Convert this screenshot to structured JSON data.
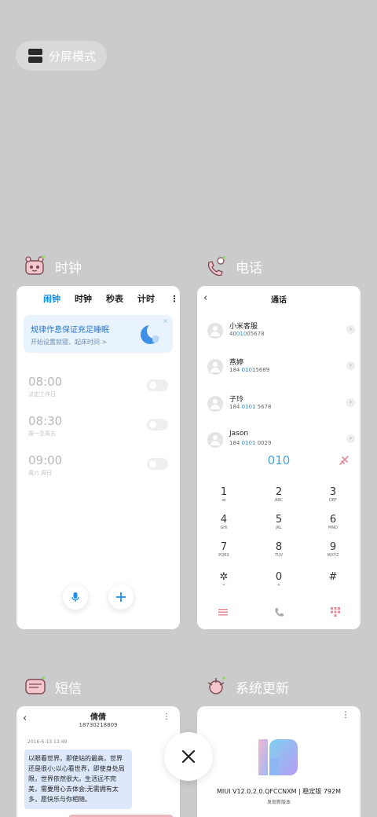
{
  "split_screen": {
    "label": "分屏模式",
    "icon": "split-screen-icon"
  },
  "apps": {
    "clock": {
      "name": "时钟",
      "icon": "clock-app-icon"
    },
    "phone": {
      "name": "电话",
      "icon": "phone-app-icon"
    },
    "sms": {
      "name": "短信",
      "icon": "sms-app-icon"
    },
    "update": {
      "name": "系统更新",
      "icon": "update-app-icon"
    }
  },
  "clock_card": {
    "tabs": [
      "闹钟",
      "时钟",
      "秒表",
      "计时"
    ],
    "active_tab": "闹钟",
    "more": "⋮",
    "banner": {
      "title": "规律作息保证充足睡眠",
      "subtitle": "开始设置就寝、起床时间 >",
      "close": "×"
    },
    "alarms": [
      {
        "time": "08:00",
        "days": "法定工作日",
        "enabled": false
      },
      {
        "time": "08:30",
        "days": "周一至周五",
        "enabled": false
      },
      {
        "time": "09:00",
        "days": "周六 周日",
        "enabled": false
      }
    ],
    "accent": "#1a8ff0"
  },
  "phone_card": {
    "title": "通话",
    "back": "‹",
    "contacts": [
      {
        "name": "小米客服",
        "num_pre": "40",
        "num_hl": "010",
        "num_post": "05678"
      },
      {
        "name": "燕婷",
        "num_pre": "184 ",
        "num_hl": "010",
        "num_post": "15689"
      },
      {
        "name": "子玲",
        "num_pre": "184 ",
        "num_hl": "0101",
        "num_post": " 5678"
      },
      {
        "name": "Jason",
        "num_pre": "184 ",
        "num_hl": "0101",
        "num_post": " 0029"
      }
    ],
    "chevron": "›",
    "dialed": "010",
    "keys": [
      {
        "d": "1",
        "l": "ꝏ"
      },
      {
        "d": "2",
        "l": "ABC"
      },
      {
        "d": "3",
        "l": "DEF"
      },
      {
        "d": "4",
        "l": "GHI"
      },
      {
        "d": "5",
        "l": "JKL"
      },
      {
        "d": "6",
        "l": "MNO"
      },
      {
        "d": "7",
        "l": "PQRS"
      },
      {
        "d": "8",
        "l": "TUV"
      },
      {
        "d": "9",
        "l": "WXYZ"
      },
      {
        "d": "✲",
        "l": "•"
      },
      {
        "d": "0",
        "l": "+"
      },
      {
        "d": "#",
        "l": ""
      }
    ]
  },
  "sms_card": {
    "title": "倩倩",
    "number": "18730218809",
    "more": "⋮",
    "back": "‹",
    "date": "2016-6-13 13:49",
    "message": "以眼看世界，即使站的最高，世界还是很小;以心看世界，即使身处局限，世界依然很大。生活远不完美，需要用心去体会;无需拥有太多，愿快乐与你相随。"
  },
  "update_card": {
    "more": "⋮",
    "version": "MIUI V12.0.2.0.QFCCNXM | 稳定版 792M",
    "sub": "发现新版本"
  },
  "close_button": {
    "icon": "close-icon",
    "glyph": "×"
  }
}
